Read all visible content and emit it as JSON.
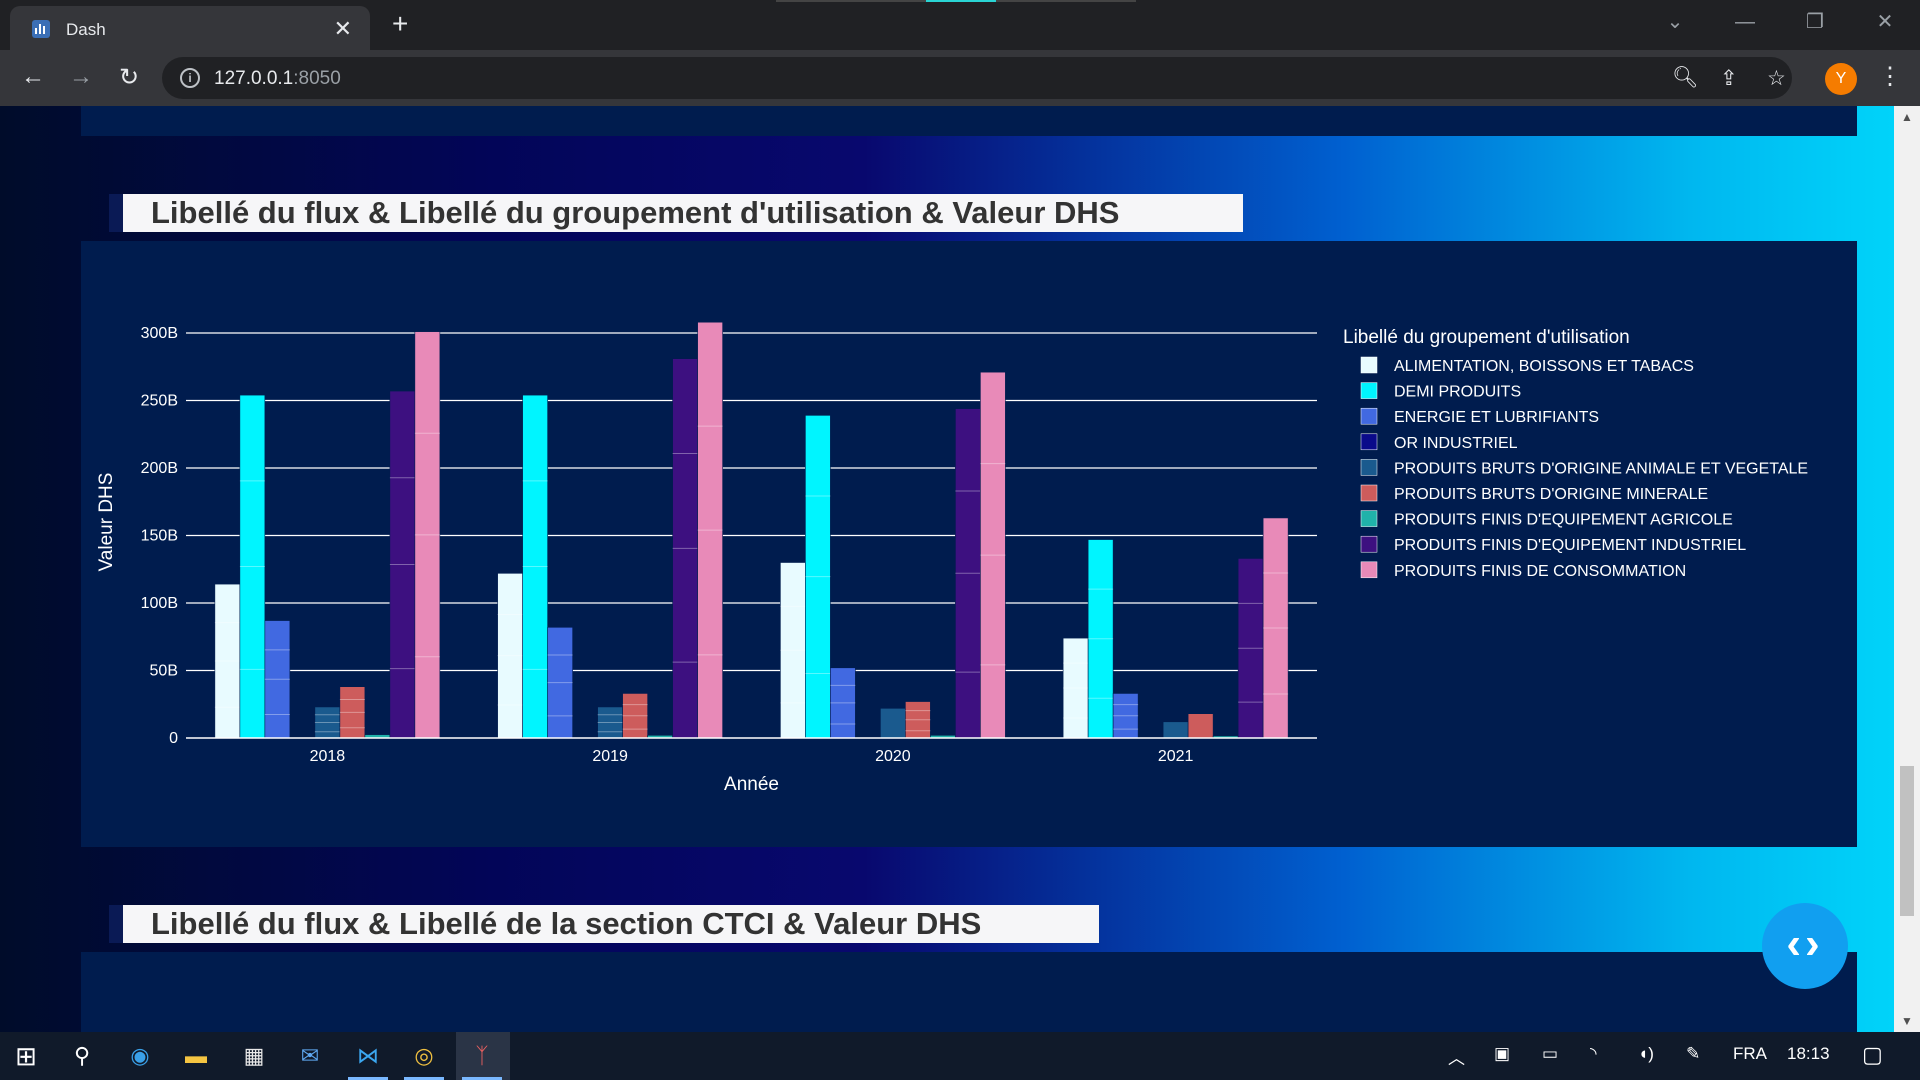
{
  "browser": {
    "tab_title": "Dash",
    "url_host": "127.0.0.1",
    "url_port": ":8050",
    "profile_initial": "Y"
  },
  "sections": [
    {
      "title": "Libellé du flux & Libellé du groupement d'utilisation & Valeur DHS"
    },
    {
      "title": "Libellé du flux & Libellé de la section CTCI & Valeur DHS"
    }
  ],
  "chart_data": {
    "type": "bar",
    "barmode": "group (stacked segments per category)",
    "xlabel": "Année",
    "ylabel": "Valeur DHS",
    "legend_title": "Libellé du groupement d'utilisation",
    "legend_position": "right",
    "ylim": [
      0,
      320000000000
    ],
    "yticks": [
      0,
      50000000000,
      100000000000,
      150000000000,
      200000000000,
      250000000000,
      300000000000
    ],
    "ytick_labels": [
      "0",
      "50B",
      "100B",
      "150B",
      "200B",
      "250B",
      "300B"
    ],
    "categories": [
      "2018",
      "2019",
      "2020",
      "2021"
    ],
    "grid": true,
    "series": [
      {
        "name": "ALIMENTATION, BOISSONS ET TABACS",
        "color": "#e8fbff",
        "values": [
          114000000000,
          122000000000,
          130000000000,
          74000000000
        ]
      },
      {
        "name": "DEMI  PRODUITS",
        "color": "#00f5ff",
        "values": [
          254000000000,
          254000000000,
          239000000000,
          147000000000
        ]
      },
      {
        "name": "ENERGIE  ET  LUBRIFIANTS",
        "color": "#4169e1",
        "values": [
          87000000000,
          82000000000,
          52000000000,
          33000000000
        ]
      },
      {
        "name": "OR INDUSTRIEL",
        "color": "#0a0a8a",
        "values": [
          600000000,
          500000000,
          400000000,
          300000000
        ]
      },
      {
        "name": "PRODUITS BRUTS D'ORIGINE ANIMALE ET VEGETALE",
        "color": "#1a5a8e",
        "values": [
          23000000000,
          23000000000,
          22000000000,
          12000000000
        ]
      },
      {
        "name": "PRODUITS BRUTS D'ORIGINE MINERALE",
        "color": "#cd5c5c",
        "values": [
          38000000000,
          33000000000,
          27000000000,
          18000000000
        ]
      },
      {
        "name": "PRODUITS FINIS D'EQUIPEMENT AGRICOLE",
        "color": "#20b2aa",
        "values": [
          2500000000,
          2000000000,
          2000000000,
          1500000000
        ]
      },
      {
        "name": "PRODUITS FINIS D'EQUIPEMENT INDUSTRIEL",
        "color": "#3d1080",
        "values": [
          257000000000,
          281000000000,
          244000000000,
          133000000000
        ]
      },
      {
        "name": "PRODUITS FINIS DE CONSOMMATION",
        "color": "#e88ab8",
        "values": [
          301000000000,
          308000000000,
          271000000000,
          163000000000
        ]
      }
    ]
  },
  "taskbar": {
    "language": "FRA",
    "time": "18:13"
  }
}
